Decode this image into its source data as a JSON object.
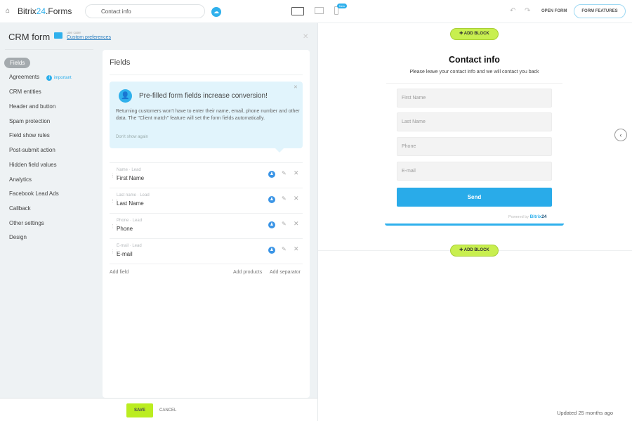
{
  "topbar": {
    "brand_prefix": "Bitrix",
    "brand_num": "24",
    "brand_suffix": ".Forms",
    "form_name": "Contact info",
    "new_badge": "New",
    "open_form": "OPEN FORM",
    "form_features": "FORM FEATURES"
  },
  "panel": {
    "title": "CRM form",
    "use_case_label": "use case",
    "use_case_value": "Custom preferences"
  },
  "sidebar": {
    "items": [
      {
        "label": "Fields"
      },
      {
        "label": "Agreements"
      },
      {
        "label": "CRM entities"
      },
      {
        "label": "Header and button"
      },
      {
        "label": "Spam protection"
      },
      {
        "label": "Field show rules"
      },
      {
        "label": "Post-submit action"
      },
      {
        "label": "Hidden field values"
      },
      {
        "label": "Analytics"
      },
      {
        "label": "Facebook Lead Ads"
      },
      {
        "label": "Callback"
      },
      {
        "label": "Other settings"
      },
      {
        "label": "Design"
      }
    ],
    "important": "important"
  },
  "fields_card": {
    "title": "Fields",
    "promo_title": "Pre-filled form fields increase conversion!",
    "promo_text": "Returning customers won't have to enter their name, email, phone number and other data. The \"Client match\" feature will set the form fields automatically.",
    "dont_show": "Don't show again",
    "rows": [
      {
        "meta": "Name · Lead",
        "name": "First Name"
      },
      {
        "meta": "Last name · Lead",
        "name": "Last Name"
      },
      {
        "meta": "Phone · Lead",
        "name": "Phone"
      },
      {
        "meta": "E-mail · Lead",
        "name": "E-mail"
      }
    ],
    "add_field": "Add field",
    "add_products": "Add products",
    "add_separator": "Add separator"
  },
  "footer": {
    "save": "SAVE",
    "cancel": "CANCEL",
    "updated": "Updated 25 months ago"
  },
  "preview": {
    "add_block": "ADD BLOCK",
    "title": "Contact info",
    "subtitle": "Please leave your contact info and we will contact you back",
    "inputs": [
      "First Name",
      "Last Name",
      "Phone",
      "E-mail"
    ],
    "send": "Send",
    "powered_by": "Powered by",
    "powered_brand": "Bitrix",
    "powered_num": "24"
  },
  "colors": {
    "accent": "#2fb0ec",
    "save": "#bbed21",
    "add_block": "#c8ef4f"
  }
}
